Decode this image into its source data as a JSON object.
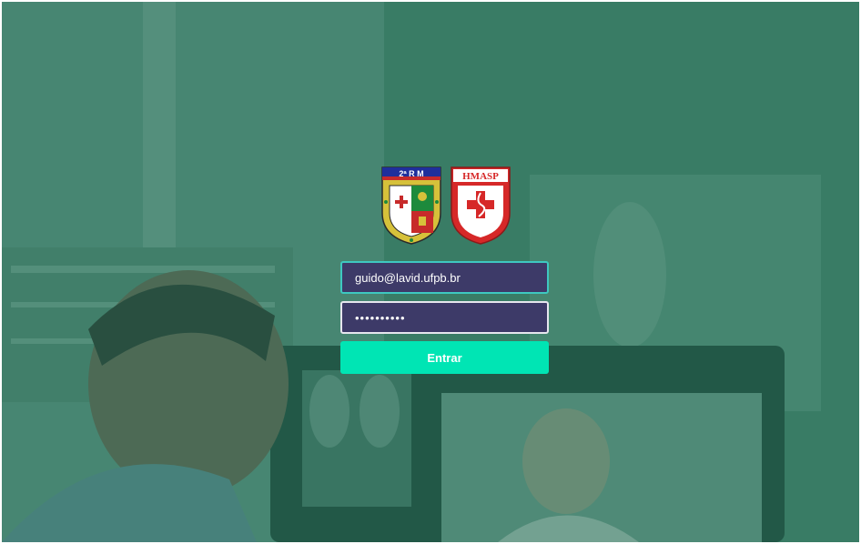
{
  "login": {
    "emblems": {
      "left_label": "2ª R M",
      "right_label": "HMASP"
    },
    "email": {
      "value": "guido@lavid.ufpb.br"
    },
    "password": {
      "value": "••••••••••"
    },
    "submit_label": "Entrar"
  },
  "colors": {
    "overlay": "#2d7a5e",
    "field_bg": "#3d3a68",
    "field_border_active": "#3ec8c0",
    "button_bg": "#00e5b4",
    "button_text": "#ffffff"
  },
  "icons": [
    "regional-command-emblem",
    "hospital-emblem"
  ]
}
